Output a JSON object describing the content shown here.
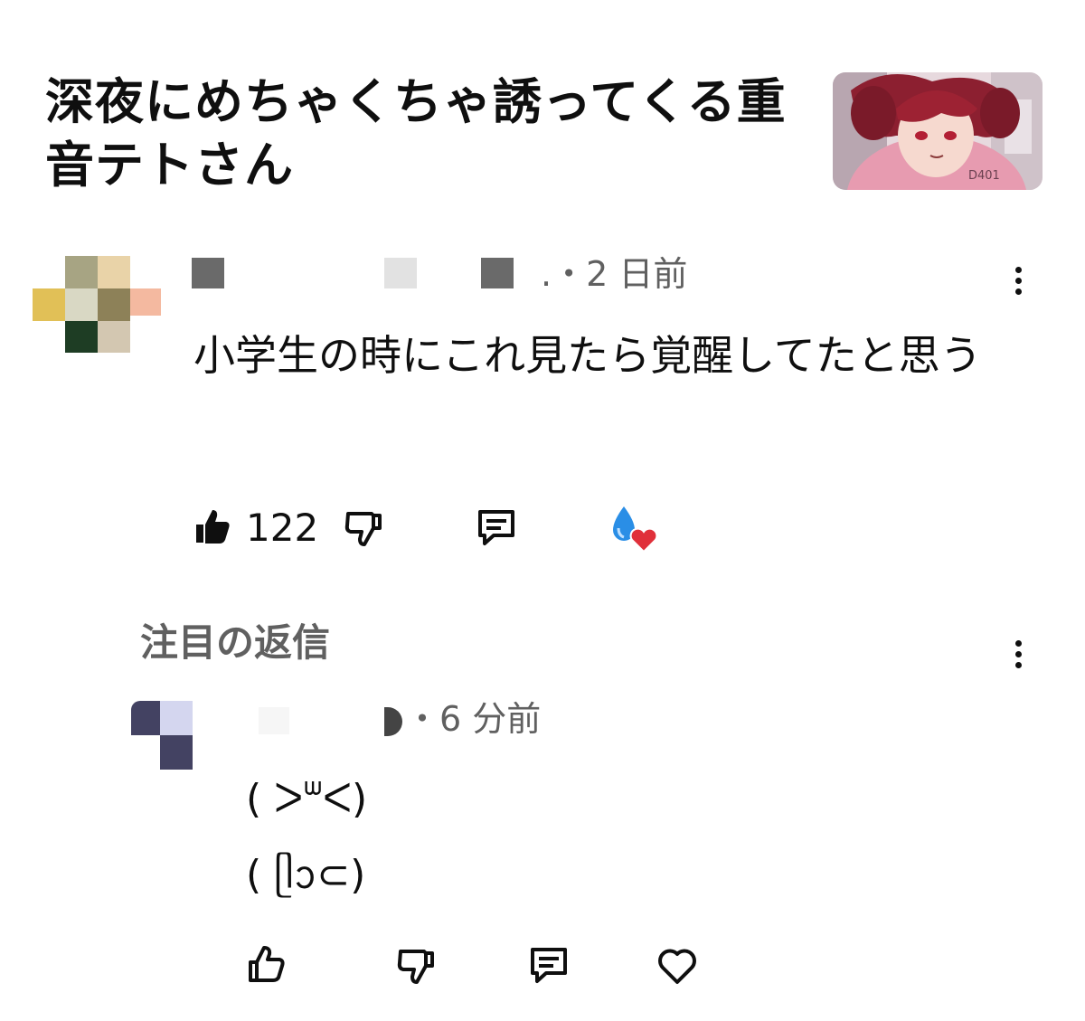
{
  "video": {
    "title": "深夜にめちゃくちゃ誘ってくる重音テトさん",
    "thumbnail_icon": "anime-girl-thumbnail",
    "thumbnail_watermark": "D401"
  },
  "comment": {
    "meta_suffix": ".・2 日前",
    "text": "小学生の時にこれ見たら覚醒してたと思う",
    "like_count": "122",
    "icons": {
      "like": "thumbs-up-filled-icon",
      "dislike": "thumbs-down-icon",
      "reply": "reply-icon",
      "creator_heart": "creator-heart-icon"
    }
  },
  "replies_section": {
    "label": "注目の返信"
  },
  "reply": {
    "meta_suffix": "・6 分前",
    "text": "( ᐳᐜᐸ)\n( ᥫᩣ⊂)",
    "icons": {
      "like": "thumbs-up-icon",
      "dislike": "thumbs-down-icon",
      "reply": "reply-icon",
      "heart": "heart-outline-icon"
    }
  },
  "colors": {
    "text": "#0f0f0f",
    "secondary": "#606060",
    "heart_red": "#e0303a",
    "drop_blue": "#2a8ee6"
  }
}
